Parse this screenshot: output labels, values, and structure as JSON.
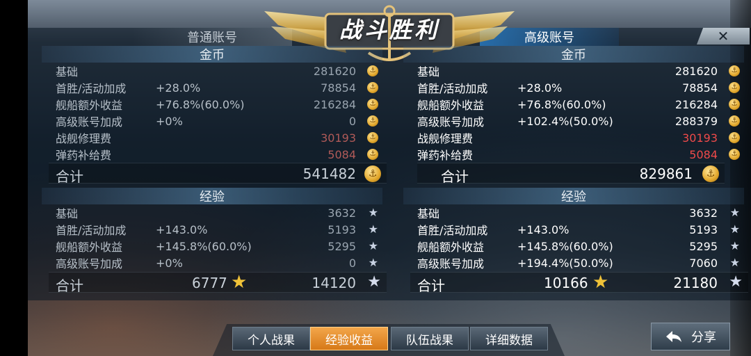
{
  "header": {
    "title": "战斗胜利",
    "normal_label": "普通账号",
    "premium_label": "高级账号",
    "close": "✕"
  },
  "normal": {
    "gold_title": "金币",
    "gold_rows": [
      {
        "label": "基础",
        "pct": "",
        "value": "281620"
      },
      {
        "label": "首胜/活动加成",
        "pct": "+28.0%",
        "value": "78854"
      },
      {
        "label": "舰船额外收益",
        "pct": "+76.8%(60.0%)",
        "value": "216284"
      },
      {
        "label": "高级账号加成",
        "pct": "+0%",
        "value": "0"
      },
      {
        "label": "战舰修理费",
        "pct": "",
        "value": "30193"
      },
      {
        "label": "弹药补给费",
        "pct": "",
        "value": "5084"
      }
    ],
    "gold_total_label": "合计",
    "gold_total": "541482",
    "exp_title": "经验",
    "exp_rows": [
      {
        "label": "基础",
        "pct": "",
        "value": "3632"
      },
      {
        "label": "首胜/活动加成",
        "pct": "+143.0%",
        "value": "5193"
      },
      {
        "label": "舰船额外收益",
        "pct": "+145.8%(60.0%)",
        "value": "5295"
      },
      {
        "label": "高级账号加成",
        "pct": "+0%",
        "value": "0"
      }
    ],
    "exp_total_label": "合计",
    "exp_captain": "6777",
    "exp_total": "14120"
  },
  "premium": {
    "gold_title": "金币",
    "gold_rows": [
      {
        "label": "基础",
        "pct": "",
        "value": "281620"
      },
      {
        "label": "首胜/活动加成",
        "pct": "+28.0%",
        "value": "78854"
      },
      {
        "label": "舰船额外收益",
        "pct": "+76.8%(60.0%)",
        "value": "216284"
      },
      {
        "label": "高级账号加成",
        "pct": "+102.4%(50.0%)",
        "value": "288379"
      },
      {
        "label": "战舰修理费",
        "pct": "",
        "value": "30193"
      },
      {
        "label": "弹药补给费",
        "pct": "",
        "value": "5084"
      }
    ],
    "gold_total_label": "合计",
    "gold_total": "829861",
    "exp_title": "经验",
    "exp_rows": [
      {
        "label": "基础",
        "pct": "",
        "value": "3632"
      },
      {
        "label": "首胜/活动加成",
        "pct": "+143.0%",
        "value": "5193"
      },
      {
        "label": "舰船额外收益",
        "pct": "+145.8%(60.0%)",
        "value": "5295"
      },
      {
        "label": "高级账号加成",
        "pct": "+194.4%(50.0%)",
        "value": "7060"
      }
    ],
    "exp_total_label": "合计",
    "exp_captain": "10166",
    "exp_total": "21180"
  },
  "tabs": [
    {
      "label": "个人战果"
    },
    {
      "label": "经验收益"
    },
    {
      "label": "队伍战果"
    },
    {
      "label": "详细数据"
    }
  ],
  "share": {
    "label": "分享"
  },
  "colors": {
    "accent": "#e88b26",
    "cost_red": "#ef4a4a",
    "gold": "#f0c238"
  }
}
